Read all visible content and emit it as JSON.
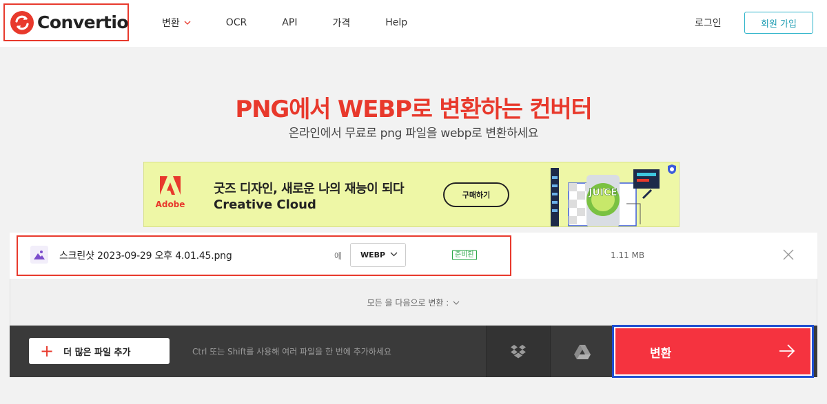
{
  "header": {
    "logo_text": "Convertio",
    "nav": [
      {
        "label": "변환",
        "has_dropdown": true
      },
      {
        "label": "OCR"
      },
      {
        "label": "API"
      },
      {
        "label": "가격"
      },
      {
        "label": "Help"
      }
    ],
    "login_label": "로그인",
    "signup_label": "회원 가입"
  },
  "hero": {
    "title": "PNG에서 WEBP로 변환하는 컨버터",
    "subtitle": "온라인에서 무료로 png 파일을 webp로 변환하세요"
  },
  "ad": {
    "brand": "Adobe",
    "headline": "굿즈 디자인, 새로운 나의 재능이 되다",
    "product": "Creative Cloud",
    "cta": "구매하기",
    "art_word": "JUICE"
  },
  "file": {
    "name": "스크린샷 2023-09-29 오후 4.01.45.png",
    "to_label": "에",
    "format": "WEBP",
    "status": "준비된",
    "size": "1.11 MB"
  },
  "convert_all": {
    "label": "모든 을 다음으로 변환 :"
  },
  "toolbar": {
    "add_files_label": "더 많은 파일 추가",
    "hint": "Ctrl 또는 Shift를 사용해 여러 파일을 한 번에 추가하세요",
    "convert_label": "변환"
  },
  "colors": {
    "brand_red": "#e8392c",
    "convert_red": "#f5333f",
    "signup_teal": "#2bb3c9",
    "ready_green": "#2ea84a",
    "highlight_blue": "#1f4fd1"
  }
}
